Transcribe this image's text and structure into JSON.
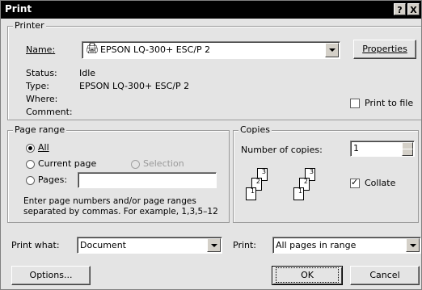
{
  "title": "Print",
  "titlebar": {
    "help_glyph": "?",
    "close_glyph": "X"
  },
  "printer": {
    "group_label": "Printer",
    "name_label": "Name:",
    "name_value": "EPSON LQ-300+ ESC/P 2",
    "properties_label": "Properties",
    "status_label": "Status:",
    "status_value": "Idle",
    "type_label": "Type:",
    "type_value": "EPSON LQ-300+ ESC/P 2",
    "where_label": "Where:",
    "comment_label": "Comment:",
    "print_to_file_label": "Print to file",
    "print_to_file_checked": false
  },
  "page_range": {
    "group_label": "Page range",
    "all_label": "All",
    "current_label": "Current page",
    "selection_label": "Selection",
    "pages_label": "Pages:",
    "pages_value": "",
    "hint": "Enter page numbers and/or page ranges separated by commas.  For example, 1,3,5–12"
  },
  "copies": {
    "group_label": "Copies",
    "number_label": "Number of copies:",
    "number_value": "1",
    "collate_label": "Collate",
    "collate_checked": true,
    "page_labels": [
      "1",
      "2",
      "3"
    ]
  },
  "footer": {
    "print_what_label": "Print what:",
    "print_what_value": "Document",
    "print_label": "Print:",
    "print_value": "All pages in range",
    "options_label": "Options...",
    "ok_label": "OK",
    "cancel_label": "Cancel"
  }
}
